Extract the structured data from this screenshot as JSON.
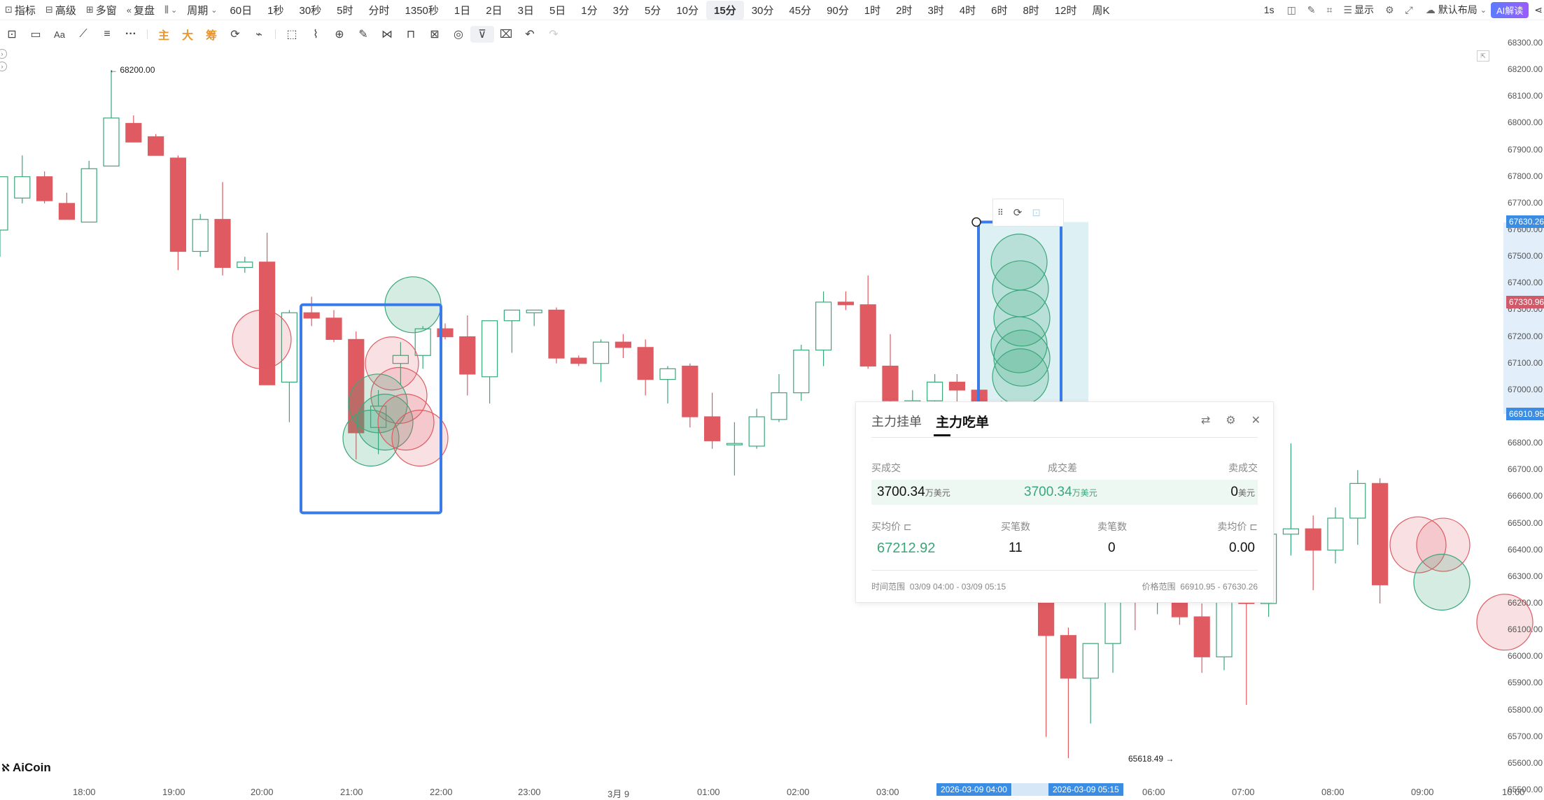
{
  "toolbar": {
    "left_items": [
      {
        "label": "指标",
        "icon": "indicator-icon"
      },
      {
        "label": "高级",
        "icon": "advanced-icon"
      },
      {
        "label": "多窗",
        "icon": "multi-window-icon"
      },
      {
        "label": "复盘",
        "icon": "replay-icon"
      },
      {
        "label": "",
        "icon": "chart-type-icon"
      }
    ],
    "period_label": "周期",
    "periods": [
      "60日",
      "1秒",
      "30秒",
      "5时",
      "分时",
      "1350秒",
      "1日",
      "2日",
      "3日",
      "5日",
      "1分",
      "3分",
      "5分",
      "10分",
      "15分",
      "30分",
      "45分",
      "90分",
      "1时",
      "2时",
      "3时",
      "4时",
      "6时",
      "8时",
      "12时",
      "周K"
    ],
    "active_period": "15分",
    "right_items": {
      "interval": "1s",
      "display": "显示",
      "layout": "默认布局",
      "ai": "AI解读"
    }
  },
  "drawbar": {
    "icons": [
      "picture-icon",
      "rectangle-icon",
      "text-icon",
      "line-icon",
      "menu-lines-icon",
      "more-icon",
      "main-icon",
      "big-icon",
      "chip-icon",
      "refresh-icon",
      "brush-icon",
      "select-icon",
      "ruler-icon",
      "zoom-icon",
      "pen-icon",
      "magnet-icon",
      "lock-icon",
      "image-icon",
      "eye-icon",
      "filter-icon",
      "trash-icon",
      "undo-icon",
      "redo-icon"
    ],
    "main_label": "主",
    "big_label": "大",
    "chip_label": "筹"
  },
  "chart_data": {
    "type": "candlestick",
    "symbol_interval": "15分",
    "ylim": [
      65500,
      68300
    ],
    "yticks": [
      68300,
      68200,
      68100,
      68000,
      67900,
      67800,
      67700,
      67600,
      67500,
      67400,
      67300,
      67200,
      67100,
      67000,
      66900,
      66800,
      66700,
      66600,
      66500,
      66400,
      66300,
      66200,
      66100,
      66000,
      65900,
      65800,
      65700,
      65600,
      65500
    ],
    "xticks": [
      "18:00",
      "19:00",
      "20:00",
      "21:00",
      "22:00",
      "23:00",
      "3月 9",
      "01:00",
      "02:00",
      "03:00",
      "06:00",
      "07:00",
      "08:00",
      "09:00",
      "10:00"
    ],
    "high_marker": "68200.00",
    "low_marker": "65618.49",
    "price_tags": [
      {
        "value": "67630.26",
        "color": "#3b8de3"
      },
      {
        "value": "67330.96",
        "color": "#d05a6a"
      },
      {
        "value": "66910.95",
        "color": "#3b8de3"
      }
    ],
    "range_start": "2026-03-09 04:00",
    "range_end": "2026-03-09 05:15",
    "candles": [
      {
        "o": 67600,
        "h": 67800,
        "l": 67500,
        "c": 67800
      },
      {
        "o": 67720,
        "h": 67880,
        "l": 67700,
        "c": 67800
      },
      {
        "o": 67800,
        "h": 67820,
        "l": 67700,
        "c": 67710
      },
      {
        "o": 67700,
        "h": 67740,
        "l": 67680,
        "c": 67640
      },
      {
        "o": 67630,
        "h": 67860,
        "l": 67640,
        "c": 67830
      },
      {
        "o": 67840,
        "h": 68200,
        "l": 67860,
        "c": 68020
      },
      {
        "o": 68000,
        "h": 68030,
        "l": 67960,
        "c": 67930
      },
      {
        "o": 67950,
        "h": 67960,
        "l": 67880,
        "c": 67880
      },
      {
        "o": 67870,
        "h": 67880,
        "l": 67450,
        "c": 67520
      },
      {
        "o": 67520,
        "h": 67660,
        "l": 67500,
        "c": 67640
      },
      {
        "o": 67640,
        "h": 67780,
        "l": 67430,
        "c": 67460
      },
      {
        "o": 67460,
        "h": 67500,
        "l": 67440,
        "c": 67480
      },
      {
        "o": 67480,
        "h": 67590,
        "l": 67100,
        "c": 67020
      },
      {
        "o": 67030,
        "h": 67300,
        "l": 66880,
        "c": 67290
      },
      {
        "o": 67290,
        "h": 67350,
        "l": 67240,
        "c": 67270
      },
      {
        "o": 67270,
        "h": 67300,
        "l": 67180,
        "c": 67190
      },
      {
        "o": 67190,
        "h": 67220,
        "l": 66740,
        "c": 66840
      },
      {
        "o": 66860,
        "h": 67000,
        "l": 66760,
        "c": 66940
      },
      {
        "o": 67100,
        "h": 67180,
        "l": 67020,
        "c": 67130
      },
      {
        "o": 67130,
        "h": 67240,
        "l": 67080,
        "c": 67230
      },
      {
        "o": 67230,
        "h": 67250,
        "l": 67190,
        "c": 67200
      },
      {
        "o": 67200,
        "h": 67280,
        "l": 66980,
        "c": 67060
      },
      {
        "o": 67050,
        "h": 67200,
        "l": 66950,
        "c": 67260
      },
      {
        "o": 67260,
        "h": 67300,
        "l": 67140,
        "c": 67300
      },
      {
        "o": 67290,
        "h": 67300,
        "l": 67240,
        "c": 67300
      },
      {
        "o": 67300,
        "h": 67310,
        "l": 67100,
        "c": 67120
      },
      {
        "o": 67120,
        "h": 67130,
        "l": 67090,
        "c": 67100
      },
      {
        "o": 67100,
        "h": 67190,
        "l": 67030,
        "c": 67180
      },
      {
        "o": 67180,
        "h": 67210,
        "l": 67120,
        "c": 67160
      },
      {
        "o": 67160,
        "h": 67190,
        "l": 66980,
        "c": 67040
      },
      {
        "o": 67040,
        "h": 67090,
        "l": 66950,
        "c": 67080
      },
      {
        "o": 67090,
        "h": 67100,
        "l": 66860,
        "c": 66900
      },
      {
        "o": 66900,
        "h": 66990,
        "l": 66780,
        "c": 66810
      },
      {
        "o": 66800,
        "h": 66880,
        "l": 66680,
        "c": 66800
      },
      {
        "o": 66790,
        "h": 66930,
        "l": 66780,
        "c": 66900
      },
      {
        "o": 66890,
        "h": 67060,
        "l": 66880,
        "c": 66990
      },
      {
        "o": 66990,
        "h": 67170,
        "l": 66960,
        "c": 67150
      },
      {
        "o": 67150,
        "h": 67370,
        "l": 67090,
        "c": 67330
      },
      {
        "o": 67330,
        "h": 67370,
        "l": 67300,
        "c": 67320
      },
      {
        "o": 67320,
        "h": 67430,
        "l": 67080,
        "c": 67090
      },
      {
        "o": 67090,
        "h": 67210,
        "l": 66920,
        "c": 66960
      },
      {
        "o": 66960,
        "h": 67000,
        "l": 66900,
        "c": 66960
      },
      {
        "o": 66960,
        "h": 67060,
        "l": 66860,
        "c": 67030
      },
      {
        "o": 67030,
        "h": 67060,
        "l": 66880,
        "c": 67000
      },
      {
        "o": 67000,
        "h": 67010,
        "l": 66880,
        "c": 66920
      },
      {
        "o": 66920,
        "h": 66960,
        "l": 66440,
        "c": 66490
      },
      {
        "o": 66490,
        "h": 66540,
        "l": 66220,
        "c": 66270
      },
      {
        "o": 66270,
        "h": 66330,
        "l": 65700,
        "c": 66080
      },
      {
        "o": 66080,
        "h": 66110,
        "l": 65620,
        "c": 65920
      },
      {
        "o": 65920,
        "h": 66050,
        "l": 65750,
        "c": 66050
      },
      {
        "o": 66050,
        "h": 66220,
        "l": 65940,
        "c": 66300
      },
      {
        "o": 66300,
        "h": 66400,
        "l": 66100,
        "c": 66240
      },
      {
        "o": 66240,
        "h": 66340,
        "l": 66160,
        "c": 66300
      },
      {
        "o": 66300,
        "h": 66350,
        "l": 66120,
        "c": 66150
      },
      {
        "o": 66150,
        "h": 66200,
        "l": 65940,
        "c": 66000
      },
      {
        "o": 66000,
        "h": 66400,
        "l": 65950,
        "c": 66350
      },
      {
        "o": 66350,
        "h": 66390,
        "l": 65820,
        "c": 66200
      },
      {
        "o": 66200,
        "h": 66500,
        "l": 66150,
        "c": 66460
      },
      {
        "o": 66460,
        "h": 66800,
        "l": 66380,
        "c": 66480
      },
      {
        "o": 66480,
        "h": 66530,
        "l": 66250,
        "c": 66400
      },
      {
        "o": 66400,
        "h": 66560,
        "l": 66350,
        "c": 66520
      },
      {
        "o": 66520,
        "h": 66700,
        "l": 66420,
        "c": 66650
      },
      {
        "o": 66650,
        "h": 66670,
        "l": 66200,
        "c": 66270
      }
    ]
  },
  "panel": {
    "tabs": [
      "主力挂单",
      "主力吃单"
    ],
    "active_tab": "主力吃单",
    "buy_volume_label": "买成交",
    "diff_label": "成交差",
    "sell_volume_label": "卖成交",
    "buy_volume": "3700.34",
    "buy_volume_unit": "万美元",
    "diff_value": "3700.34",
    "diff_unit": "万美元",
    "sell_volume": "0",
    "sell_volume_unit": "美元",
    "avg_buy_label": "买均价",
    "buy_count_label": "买笔数",
    "sell_count_label": "卖笔数",
    "avg_sell_label": "卖均价",
    "avg_buy_value": "67212.92",
    "buy_count": "11",
    "sell_count": "0",
    "avg_sell_value": "0.00",
    "time_range_label": "时间范围",
    "time_range_value": "03/09 04:00 - 03/09 05:15",
    "price_range_label": "价格范围",
    "price_range_value": "66910.95 - 67630.26"
  },
  "logo": {
    "text": "AiCoin"
  },
  "colors": {
    "up": "#3aa77a",
    "down": "#e05a62",
    "selection": "#3b7be8"
  }
}
